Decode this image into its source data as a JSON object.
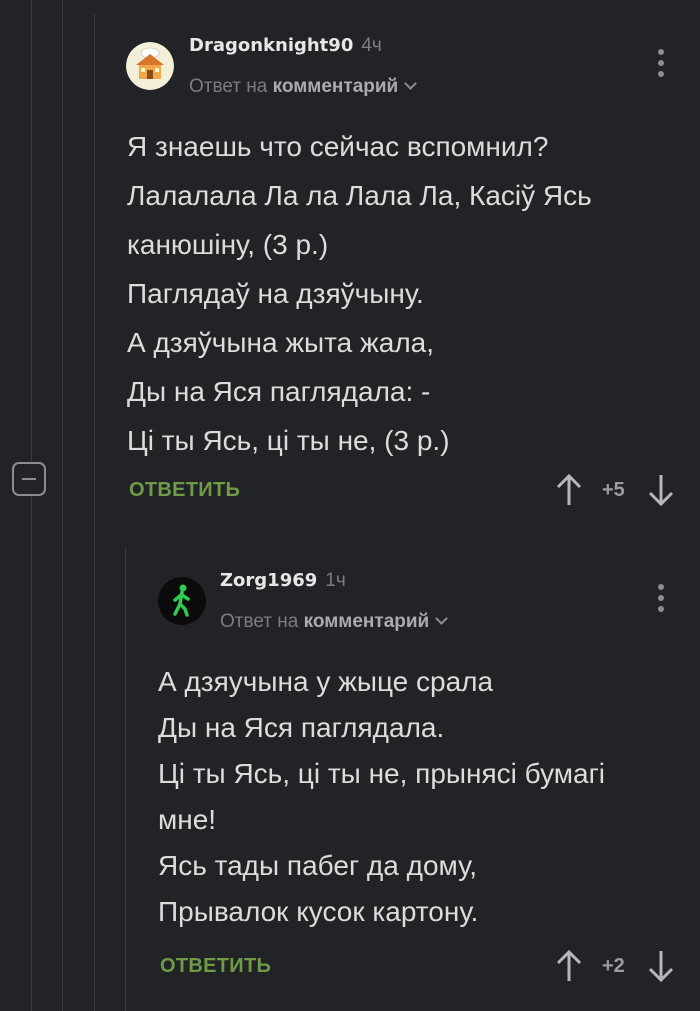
{
  "comments": [
    {
      "username": "Dragonknight90",
      "time": "4ч",
      "reply_prefix": "Ответ на",
      "reply_target": "комментарий",
      "lines": [
        "Я знаешь что сейчас вспомнил?",
        "Лалалала Ла ла Лала Ла, Касіў Ясь",
        "канюшіну, (3 р.)",
        "Паглядаў на дзяўчыну.",
        "А дзяўчына жыта жала,",
        "Ды на Яся паглядала: -",
        "Ці ты Ясь, ці ты не, (3 р.)"
      ],
      "reply_label": "ОТВЕТИТЬ",
      "score": "+5",
      "avatar_icon": "house-cloud-avatar-icon"
    },
    {
      "username": "Zorg1969",
      "time": "1ч",
      "reply_prefix": "Ответ на",
      "reply_target": "комментарий",
      "lines": [
        "А дзяучына у жыце срала",
        "Ды на Яся паглядала.",
        "Ці ты Ясь, ці ты не, прынясі бумагі",
        "мне!",
        "Ясь тады пабег да дому,",
        "Прывалок кусок картону."
      ],
      "reply_label": "ОТВЕТИТЬ",
      "score": "+2",
      "avatar_icon": "walking-man-avatar-icon"
    }
  ],
  "colors": {
    "background": "#222326",
    "accent_reply": "#6f9a46",
    "muted": "#7b7d82"
  }
}
